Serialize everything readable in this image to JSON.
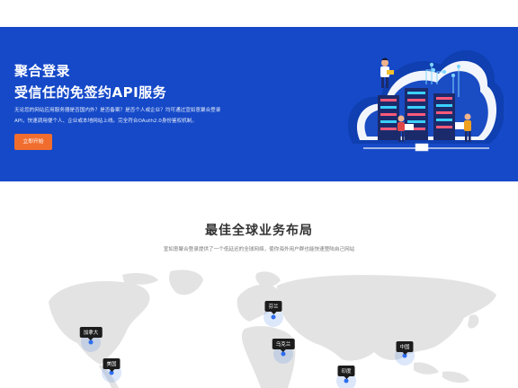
{
  "hero": {
    "title_line1": "聚合登录",
    "title_line2": "受信任的免签约API服务",
    "desc_line1": "无论您的网站应用服务器是否国内外？是否备案？是否个人或企业？均可通过宣如意聚合登录",
    "desc_line2": "API，快速调用便个人、企业或本地网站上线。完全符合OAuth2.0身份鉴权机制。",
    "cta_label": "立即开始"
  },
  "section": {
    "title": "最佳全球业务布局",
    "subtitle": "宣如意聚合登录提供了一个低延迟的全球网络，使你海外用户群也能快速登陆自己网站"
  },
  "map": {
    "locations": [
      {
        "name": "加拿大"
      },
      {
        "name": "美国"
      },
      {
        "name": "芬兰"
      },
      {
        "name": "乌克兰"
      },
      {
        "name": "印度"
      },
      {
        "name": "中国"
      }
    ]
  },
  "colors": {
    "hero_bg": "#1549c8",
    "cta": "#f06d2e",
    "pin": "#2d6df0",
    "map_land": "#e3e3e3"
  }
}
